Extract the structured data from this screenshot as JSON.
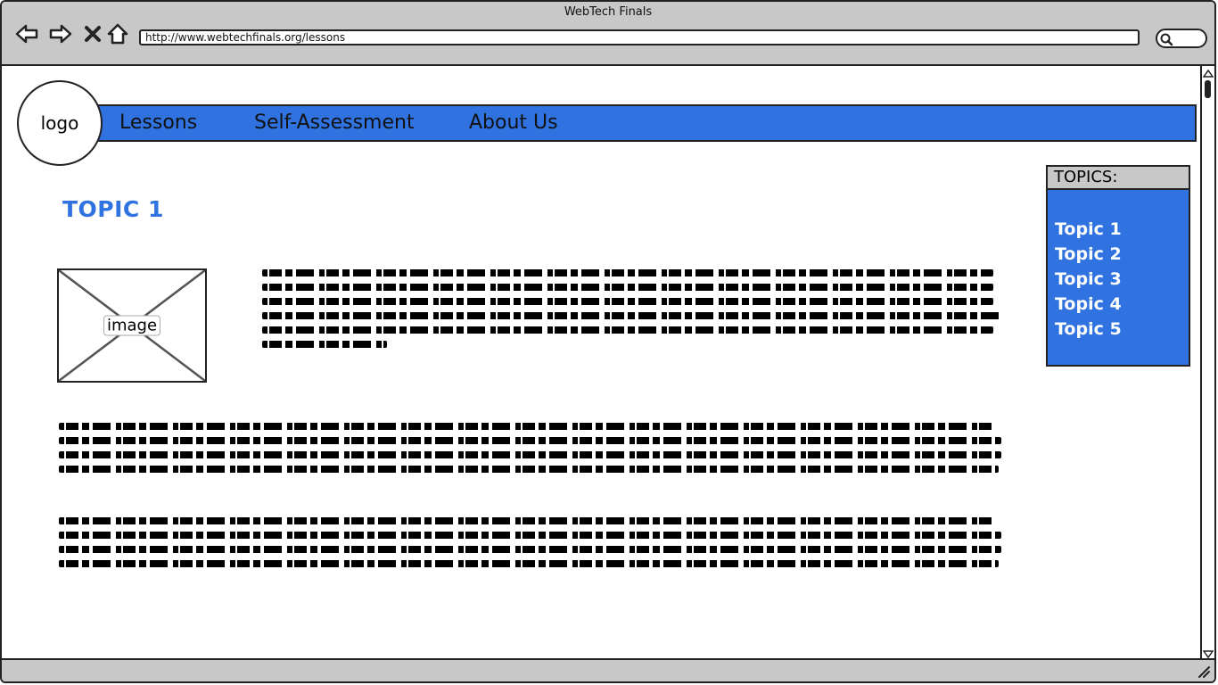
{
  "window": {
    "title": "WebTech Finals"
  },
  "browser": {
    "url": "http://www.webtechfinals.org/lessons",
    "icons": [
      "back-arrow-icon",
      "forward-arrow-icon",
      "stop-icon",
      "home-icon",
      "search-icon"
    ]
  },
  "logo": {
    "label": "logo"
  },
  "nav": {
    "items": [
      {
        "label": "Lessons"
      },
      {
        "label": "Self-Assessment"
      },
      {
        "label": "About Us"
      }
    ]
  },
  "main": {
    "title": "TOPIC 1",
    "image_label": "image"
  },
  "sidebar": {
    "heading": "TOPICS:",
    "items": [
      {
        "label": "Topic 1"
      },
      {
        "label": "Topic 2"
      },
      {
        "label": "Topic 3"
      },
      {
        "label": "Topic 4"
      },
      {
        "label": "Topic 5"
      }
    ]
  },
  "colors": {
    "accent": "#2f72e0",
    "chrome": "#c8c8c8"
  }
}
